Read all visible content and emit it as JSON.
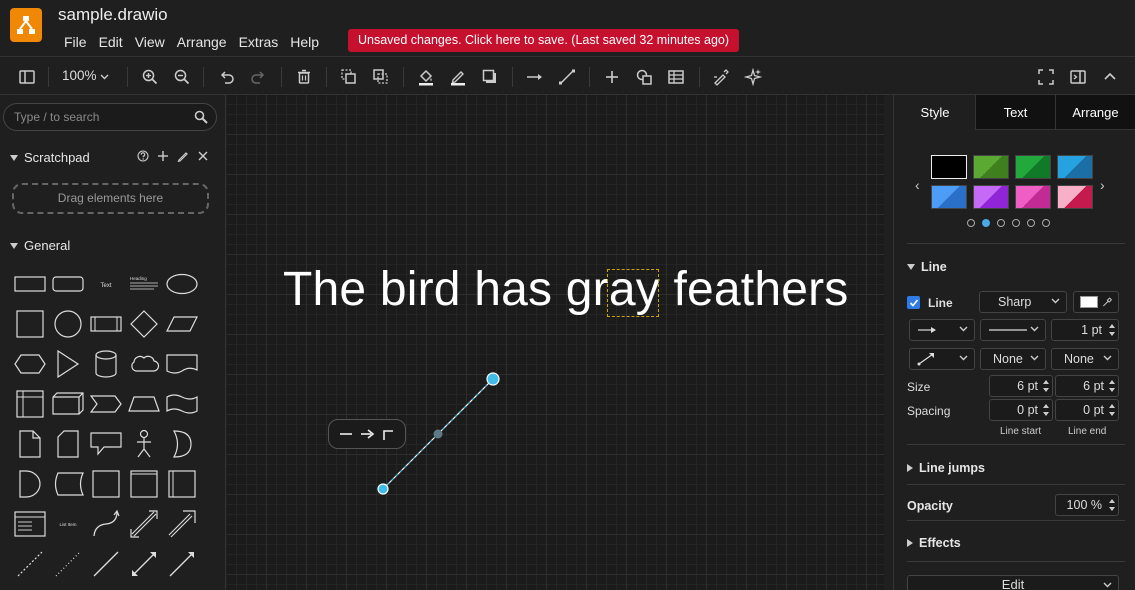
{
  "app": {
    "file_name": "sample.drawio",
    "menus": [
      "File",
      "Edit",
      "View",
      "Arrange",
      "Extras",
      "Help"
    ],
    "unsaved_message": "Unsaved changes. Click here to save. (Last saved 32 minutes ago)",
    "logo_color": "#f08705",
    "alert_color": "#c5102e"
  },
  "toolbar": {
    "zoom": "100%",
    "buttons": [
      "format-panel",
      "zoom-in",
      "zoom-out",
      "undo",
      "redo",
      "delete",
      "to-front",
      "to-back",
      "fill-color",
      "line-color",
      "shadow",
      "connection",
      "waypoints",
      "insert",
      "shapes",
      "table",
      "edit-style",
      "generate",
      "fullscreen",
      "toggle-format",
      "collapse"
    ]
  },
  "left_panel": {
    "search_placeholder": "Type / to search",
    "scratchpad_title": "Scratchpad",
    "scratchpad_drop": "Drag elements here",
    "general_title": "General"
  },
  "canvas": {
    "text": "The bird has gray feathers",
    "selected_word": "gray",
    "accent_color": "#3fbce8"
  },
  "format_panel": {
    "tabs": [
      "Style",
      "Text",
      "Arrange"
    ],
    "active_tab": "Style",
    "line_section": "Line",
    "line_checkbox": "Line",
    "line_style": "Sharp",
    "line_width": "1 pt",
    "start_arrow": "None",
    "end_arrow": "None",
    "size_label": "Size",
    "size_start": "6 pt",
    "size_end": "6 pt",
    "spacing_label": "Spacing",
    "spacing_start": "0 pt",
    "spacing_end": "0 pt",
    "line_start_label": "Line start",
    "line_end_label": "Line end",
    "line_jumps": "Line jumps",
    "opacity_label": "Opacity",
    "opacity_value": "100 %",
    "effects": "Effects",
    "edit_button": "Edit",
    "swatches": [
      "#000000",
      "#4b9a2a",
      "#1d9a38",
      "#1f8fd0",
      "#3b8ef0",
      "#b14cf5",
      "#e14ab8",
      "#f59ab8"
    ],
    "swatch_page": 2,
    "swatch_pages": 6
  }
}
